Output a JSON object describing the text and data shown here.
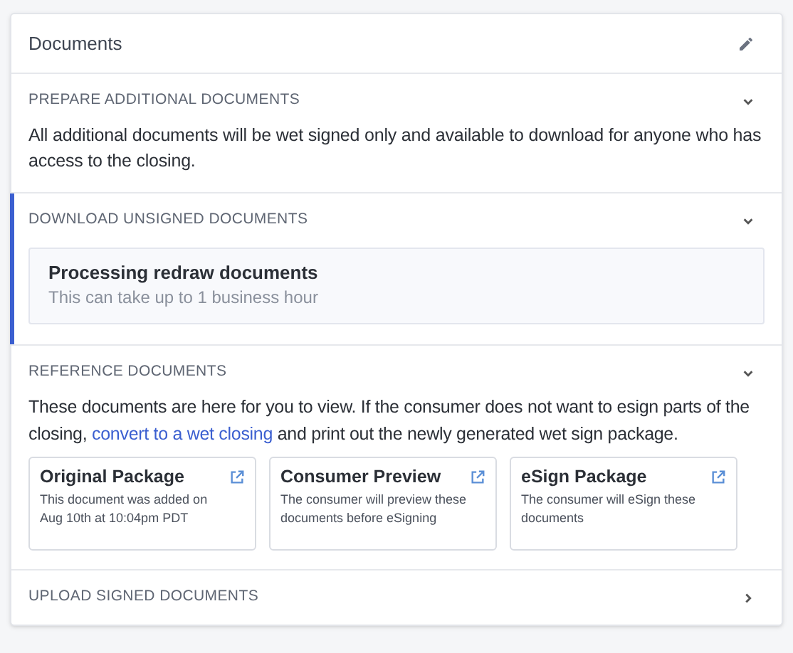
{
  "panel": {
    "title": "Documents"
  },
  "sections": [
    {
      "kind": "text",
      "heading": "PREPARE ADDITIONAL DOCUMENTS",
      "expanded": true,
      "active": false,
      "body": "All additional documents will be wet signed only and available to download for anyone who has access to the closing."
    },
    {
      "kind": "status",
      "heading": "DOWNLOAD UNSIGNED DOCUMENTS",
      "expanded": true,
      "active": true,
      "status_title": "Processing redraw documents",
      "status_detail": "This can take up to 1 business hour"
    },
    {
      "kind": "reference",
      "heading": "REFERENCE DOCUMENTS",
      "expanded": true,
      "active": false,
      "text_before": "These documents are here for you to view. If the consumer does not want to esign parts of the closing,",
      "link": "convert to a wet closing",
      "text_after": "and print out the newly generated wet sign package.",
      "cards": [
        {
          "title": "Original Package",
          "description": "This document was added on Aug 10th at 10:04pm PDT"
        },
        {
          "title": "Consumer Preview",
          "description": "The consumer will preview these documents before eSigning"
        },
        {
          "title": "eSign Package",
          "description": "The consumer will eSign these documents"
        }
      ]
    },
    {
      "heading": "UPLOAD SIGNED DOCUMENTS",
      "expanded": false,
      "active": false
    }
  ]
}
